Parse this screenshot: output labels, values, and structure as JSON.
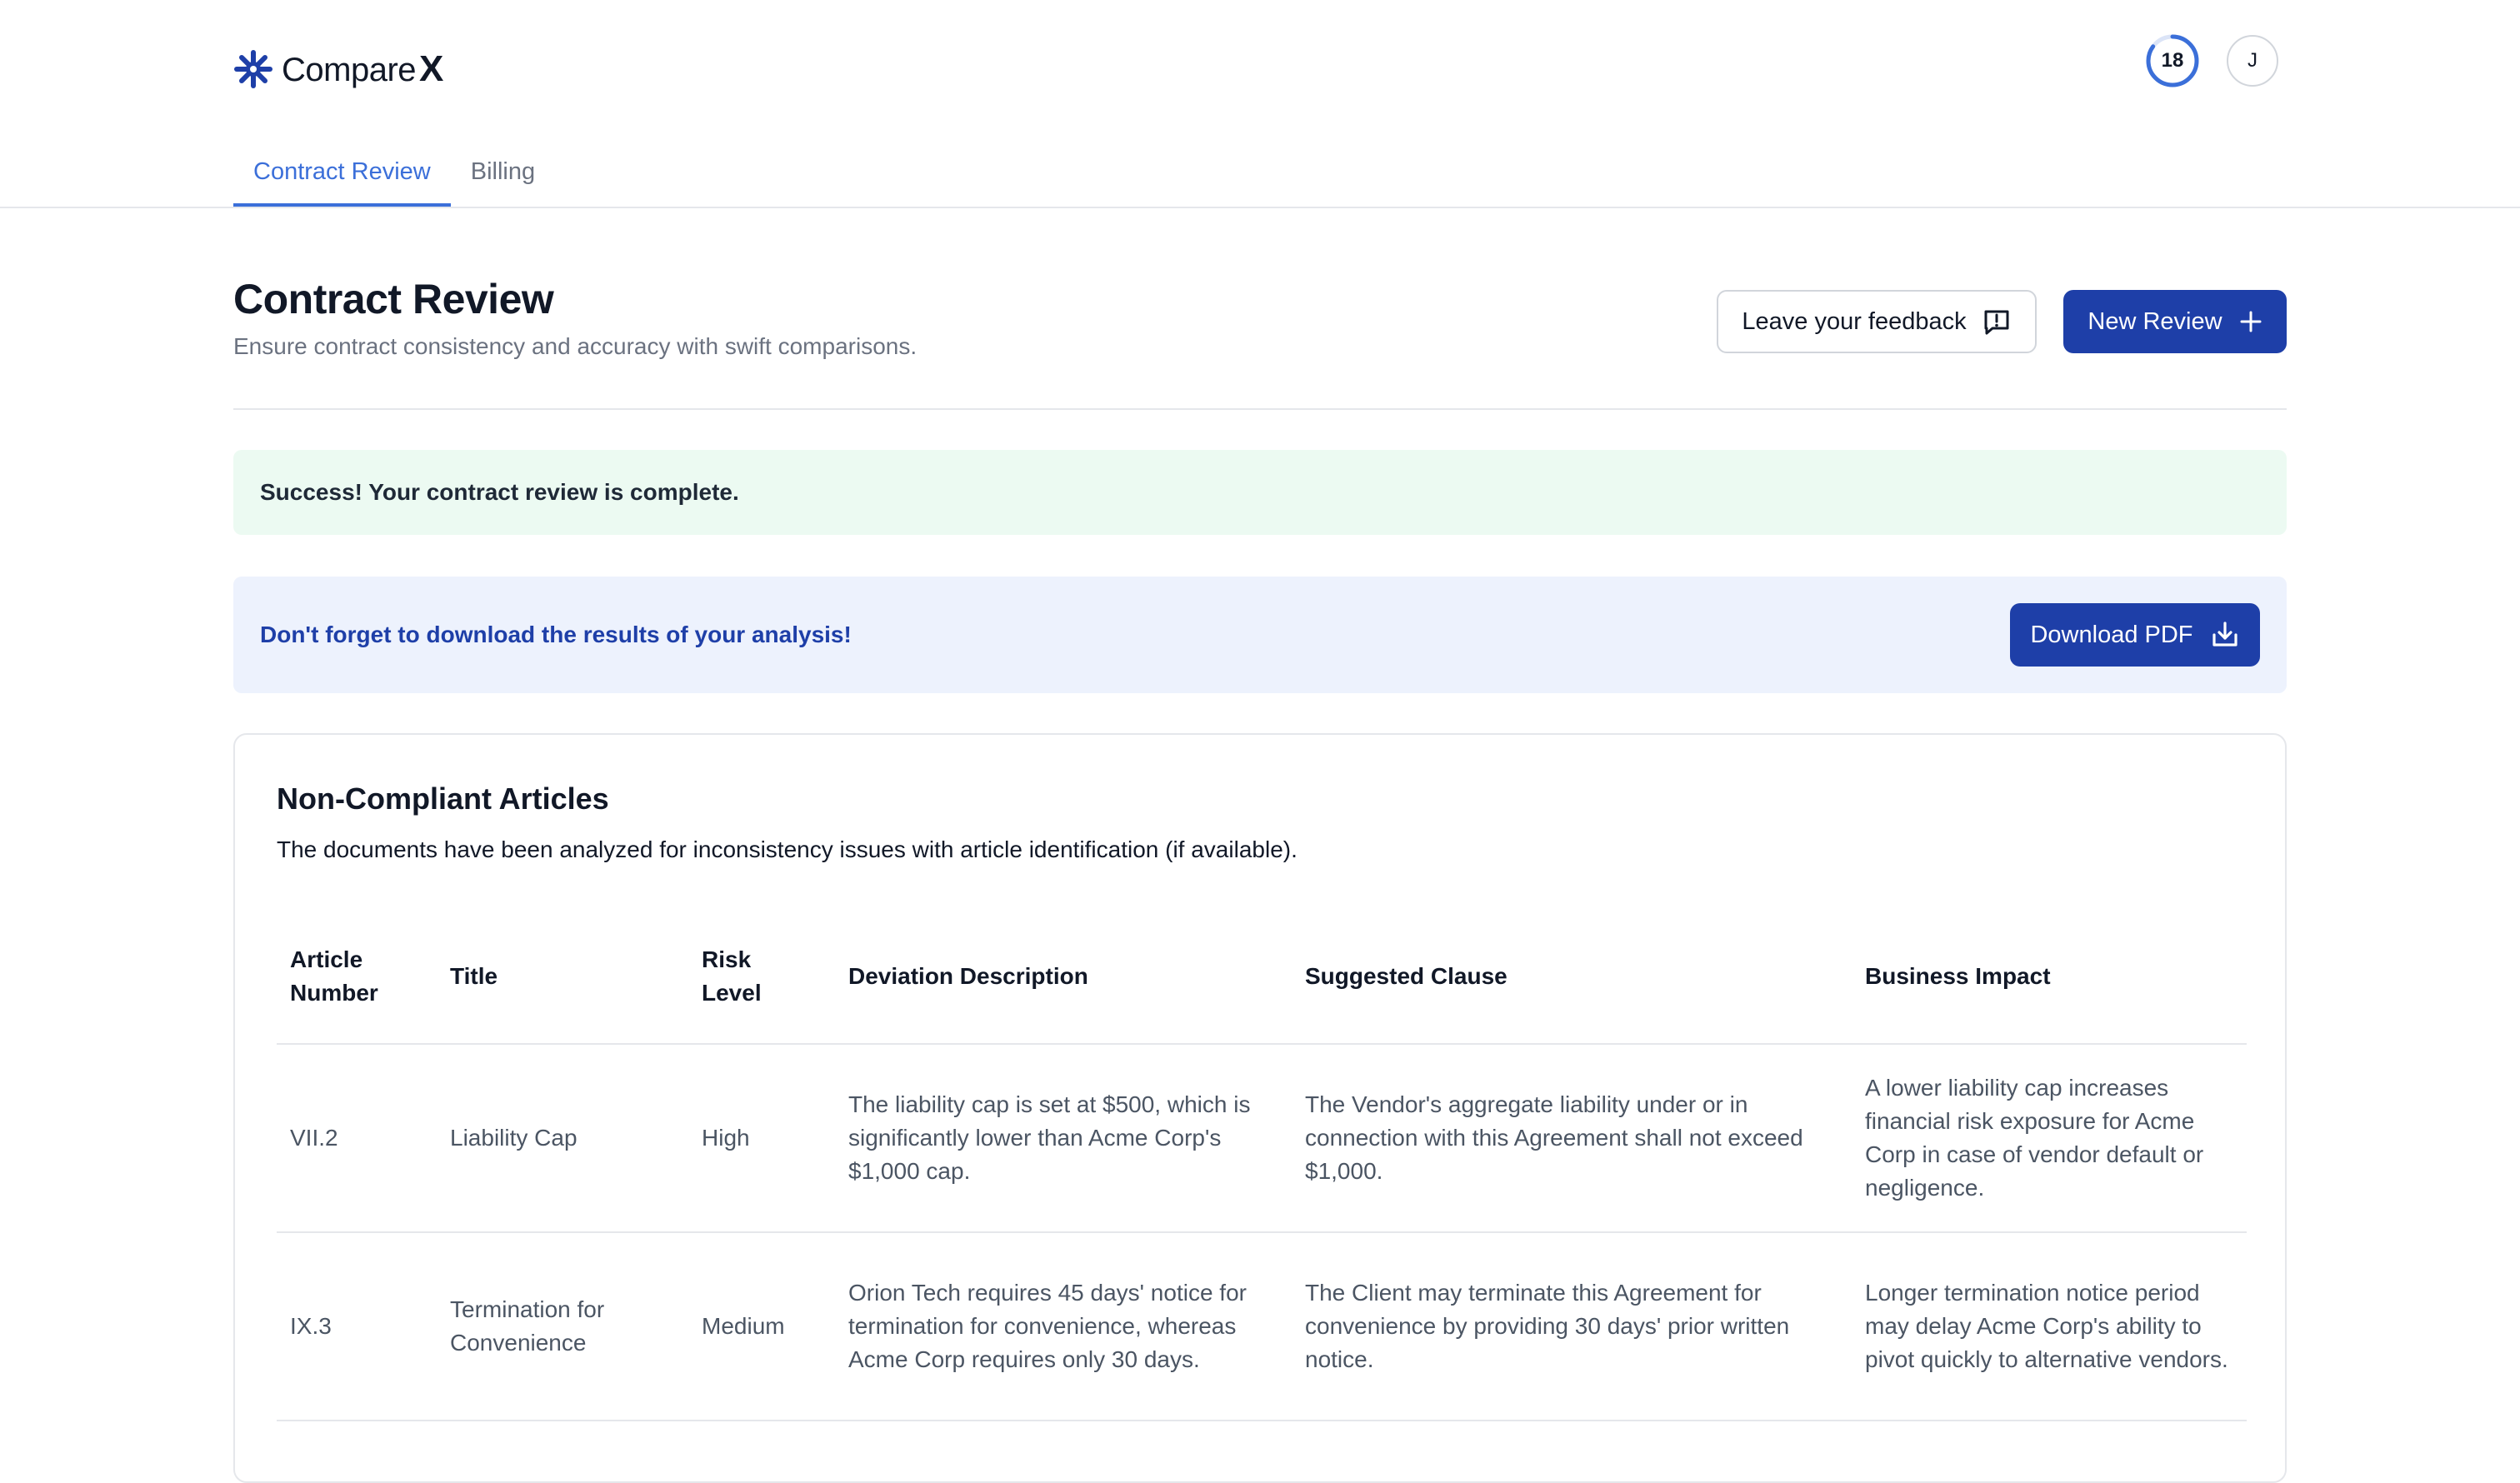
{
  "app": {
    "logo_text": "Compare",
    "logo_mark": "X",
    "logo_icon": "sparkle-logo-icon"
  },
  "header": {
    "credits": "18",
    "credits_progress": 0.85,
    "avatar_initial": "J",
    "accent": "#3b6fd9"
  },
  "tabs": [
    {
      "label": "Contract Review",
      "active": true
    },
    {
      "label": "Billing",
      "active": false
    }
  ],
  "page": {
    "title": "Contract Review",
    "subtitle": "Ensure contract consistency and accuracy with swift comparisons.",
    "feedback_label": "Leave your feedback",
    "new_review_label": "New Review"
  },
  "alerts": {
    "success": "Success! Your contract review is complete.",
    "info": "Don't forget to download the results of your analysis!",
    "download_label": "Download PDF"
  },
  "non_compliant": {
    "title": "Non-Compliant Articles",
    "description": "The documents have been analyzed for inconsistency issues with article identification (if available).",
    "columns": [
      "Article Number",
      "Title",
      "Risk Level",
      "Deviation Description",
      "Suggested Clause",
      "Business Impact"
    ],
    "rows": [
      {
        "article": "VII.2",
        "title": "Liability Cap",
        "risk": "High",
        "deviation": "The liability cap is set at $500, which is significantly lower than Acme Corp's $1,000 cap.",
        "suggested": "The Vendor's aggregate liability under or in connection with this Agreement shall not exceed $1,000.",
        "impact": "A lower liability cap increases financial risk exposure for Acme Corp in case of vendor default or negligence."
      },
      {
        "article": "IX.3",
        "title": "Termination for Convenience",
        "risk": "Medium",
        "deviation": "Orion Tech requires 45 days' notice for termination for convenience, whereas Acme Corp requires only 30 days.",
        "suggested": "The Client may terminate this Agreement for convenience by providing 30 days' prior written notice.",
        "impact": "Longer termination notice period may delay Acme Corp's ability to pivot quickly to alternative vendors."
      }
    ]
  }
}
